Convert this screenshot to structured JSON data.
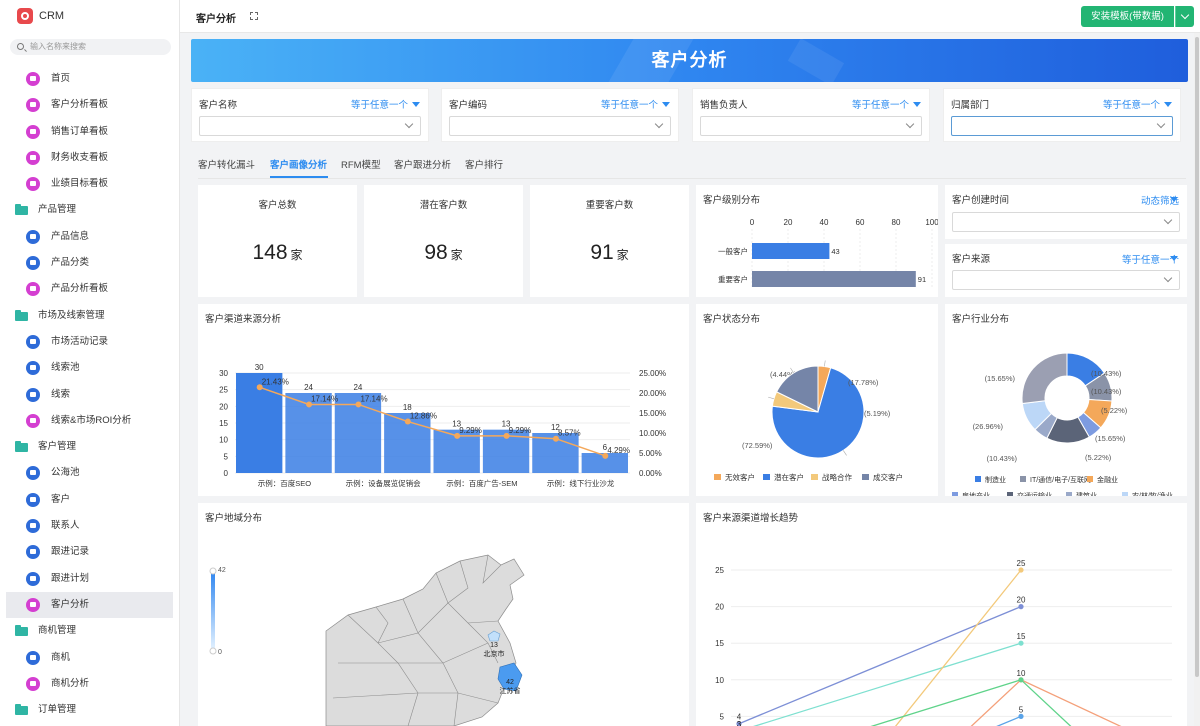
{
  "app": {
    "name": "CRM"
  },
  "search": {
    "placeholder": "输入名称来搜索"
  },
  "sidebar": {
    "items": [
      {
        "type": "child",
        "label": "首页",
        "icon": "dashboard-icon",
        "color": "pink"
      },
      {
        "type": "child",
        "label": "客户分析看板",
        "icon": "dashboard-icon",
        "color": "pink"
      },
      {
        "type": "child",
        "label": "销售订单看板",
        "icon": "dashboard-icon",
        "color": "pink"
      },
      {
        "type": "child",
        "label": "财务收支看板",
        "icon": "dashboard-icon",
        "color": "pink"
      },
      {
        "type": "child",
        "label": "业绩目标看板",
        "icon": "dashboard-icon",
        "color": "pink"
      },
      {
        "type": "group",
        "label": "产品管理",
        "icon": "folder-icon"
      },
      {
        "type": "child",
        "label": "产品信息",
        "icon": "list-icon",
        "color": "blue"
      },
      {
        "type": "child",
        "label": "产品分类",
        "icon": "category-icon",
        "color": "blue"
      },
      {
        "type": "child",
        "label": "产品分析看板",
        "icon": "dashboard-icon",
        "color": "pink"
      },
      {
        "type": "group",
        "label": "市场及线索管理",
        "icon": "folder-icon"
      },
      {
        "type": "child",
        "label": "市场活动记录",
        "icon": "list-icon",
        "color": "blue"
      },
      {
        "type": "child",
        "label": "线索池",
        "icon": "pool-icon",
        "color": "blue"
      },
      {
        "type": "child",
        "label": "线索",
        "icon": "clue-icon",
        "color": "blue"
      },
      {
        "type": "child",
        "label": "线索&市场ROI分析",
        "icon": "dashboard-icon",
        "color": "pink"
      },
      {
        "type": "group",
        "label": "客户管理",
        "icon": "folder-icon"
      },
      {
        "type": "child",
        "label": "公海池",
        "icon": "pool-icon",
        "color": "blue"
      },
      {
        "type": "child",
        "label": "客户",
        "icon": "user-icon",
        "color": "blue"
      },
      {
        "type": "child",
        "label": "联系人",
        "icon": "contact-icon",
        "color": "blue"
      },
      {
        "type": "child",
        "label": "跟进记录",
        "icon": "record-icon",
        "color": "blue"
      },
      {
        "type": "child",
        "label": "跟进计划",
        "icon": "plan-icon",
        "color": "blue"
      },
      {
        "type": "child",
        "label": "客户分析",
        "icon": "dashboard-icon",
        "color": "pink",
        "active": true
      },
      {
        "type": "group",
        "label": "商机管理",
        "icon": "folder-icon"
      },
      {
        "type": "child",
        "label": "商机",
        "icon": "opportunity-icon",
        "color": "blue"
      },
      {
        "type": "child",
        "label": "商机分析",
        "icon": "dashboard-icon",
        "color": "pink"
      },
      {
        "type": "group",
        "label": "订单管理",
        "icon": "folder-icon"
      }
    ]
  },
  "topbar": {
    "tab": "客户分析",
    "install_label": "安装模板(带数据)"
  },
  "banner": {
    "title": "客户分析"
  },
  "filters": [
    {
      "label": "客户名称",
      "op": "等于任意一个"
    },
    {
      "label": "客户编码",
      "op": "等于任意一个"
    },
    {
      "label": "销售负责人",
      "op": "等于任意一个"
    },
    {
      "label": "归属部门",
      "op": "等于任意一个"
    }
  ],
  "tabs": [
    "客户转化漏斗",
    "客户画像分析",
    "RFM模型",
    "客户跟进分析",
    "客户排行"
  ],
  "kpis": [
    {
      "label": "客户总数",
      "value": "148",
      "unit": "家"
    },
    {
      "label": "潜在客户数",
      "value": "98",
      "unit": "家"
    },
    {
      "label": "重要客户数",
      "value": "91",
      "unit": "家"
    }
  ],
  "side_filters": [
    {
      "label": "客户创建时间",
      "op": "动态筛选"
    },
    {
      "label": "客户来源",
      "op": "等于任意一个"
    }
  ],
  "colors": {
    "blue": "#3a7ee4",
    "orange": "#f4a85a",
    "green": "#22b573",
    "slate": "#7585a8",
    "gray": "#d9d9d9"
  },
  "chart_data": [
    {
      "id": "level",
      "type": "bar",
      "orientation": "horizontal",
      "title": "客户级别分布",
      "categories": [
        "一般客户",
        "重要客户"
      ],
      "values": [
        43,
        91
      ],
      "xlim": [
        0,
        100
      ],
      "xticks": [
        0,
        20,
        40,
        60,
        80,
        100
      ],
      "colors": [
        "#3a7ee4",
        "#7585a8"
      ]
    },
    {
      "id": "channel",
      "type": "bar+line",
      "title": "客户渠道来源分析",
      "categories": [
        "示例：百度SEO",
        "示例：设备展览促销会",
        "示例：百度广告-SEM",
        "示例：线下行业沙龙",
        "",
        "",
        "",
        ""
      ],
      "xticklabels": [
        "示例：百度SEO",
        "示例：设备展览促销会",
        "示例：百度广告-SEM",
        "示例：线下行业沙龙"
      ],
      "series": [
        {
          "name": "客户数量",
          "type": "bar",
          "values": [
            30,
            24,
            24,
            18,
            13,
            13,
            12,
            6
          ],
          "color": "#3a7ee4"
        },
        {
          "name": "渠道占比",
          "type": "line",
          "values": [
            21.43,
            17.14,
            17.14,
            12.86,
            9.29,
            9.29,
            8.57,
            4.29
          ],
          "labels": [
            "21.43%",
            "17.14%",
            "17.14%",
            "12.86%",
            "9.29%",
            "9.29%",
            "8.57%",
            "4.29%"
          ],
          "color": "#f4a85a"
        }
      ],
      "ylim": [
        0,
        30
      ],
      "yticks": [
        0,
        5,
        10,
        15,
        20,
        25,
        30
      ],
      "y2lim": [
        0,
        25
      ],
      "y2ticks": [
        "0.00%",
        "5.00%",
        "10.00%",
        "15.00%",
        "20.00%",
        "25.00%"
      ]
    },
    {
      "id": "status",
      "type": "pie",
      "title": "客户状态分布",
      "slices": [
        {
          "name": "无效客户",
          "value": 4.44,
          "label": "(4.44%)",
          "color": "#f4a85a"
        },
        {
          "name": "潜在客户",
          "value": 72.59,
          "label": "(72.59%)",
          "color": "#3a7ee4"
        },
        {
          "name": "战略合作",
          "value": 5.19,
          "label": "(5.19%)",
          "color": "#f3c97b"
        },
        {
          "name": "成交客户",
          "value": 17.78,
          "label": "(17.78%)",
          "color": "#7585a8"
        }
      ]
    },
    {
      "id": "industry",
      "type": "pie",
      "donut": true,
      "title": "客户行业分布",
      "slices": [
        {
          "name": "制造业",
          "value": 15.65,
          "label": "(15.65%)",
          "color": "#3a7ee4"
        },
        {
          "name": "IT/通信/电子/互联网",
          "value": 10.43,
          "label": "(10.43%)",
          "color": "#8a93a8"
        },
        {
          "name": "金融业",
          "value": 10.43,
          "label": "(10.43%)",
          "color": "#f4a85a"
        },
        {
          "name": "房地产业",
          "value": 5.22,
          "label": "(5.22%)",
          "color": "#7d9be0"
        },
        {
          "name": "交通运输业",
          "value": 15.65,
          "label": "(15.65%)",
          "color": "#5b6478"
        },
        {
          "name": "建筑业",
          "value": 5.22,
          "label": "(5.22%)",
          "color": "#9aa9c9"
        },
        {
          "name": "农/林/牧/渔业",
          "value": 10.43,
          "label": "(10.43%)",
          "color": "#bcd7f7"
        },
        {
          "name": "贸易/批发/零售/租赁业",
          "value": 26.96,
          "label": "(26.96%)",
          "color": "#9b9fb2"
        }
      ]
    },
    {
      "id": "region",
      "type": "map",
      "title": "客户地域分布",
      "scale": {
        "min": "0",
        "max": "42"
      },
      "regions": [
        {
          "name": "北京市",
          "value": 13
        },
        {
          "name": "江苏省",
          "value": 42
        }
      ]
    },
    {
      "id": "trend",
      "type": "line",
      "title": "客户来源渠道增长趋势",
      "yticks": [
        0,
        5,
        10,
        15,
        20,
        25
      ],
      "ylim": [
        0,
        25
      ],
      "x": [
        1,
        2,
        3,
        4,
        5,
        6,
        7
      ],
      "series": [
        {
          "color": "#7d8fd6",
          "values": [
            4,
            null,
            null,
            null,
            20,
            null,
            null
          ],
          "labels": [
            "4",
            "",
            "",
            "",
            "20",
            "",
            ""
          ]
        },
        {
          "color": "#7ee0d0",
          "values": [
            3,
            null,
            null,
            null,
            15,
            null,
            null
          ],
          "labels": [
            "3",
            "",
            "",
            "",
            "15",
            "",
            ""
          ]
        },
        {
          "color": "#f3c97b",
          "values": [
            3,
            1,
            1,
            null,
            25,
            null,
            null
          ],
          "labels": [
            "3",
            "1",
            "1",
            "",
            "25",
            "",
            ""
          ]
        },
        {
          "color": "#f4a07a",
          "values": [
            1,
            1,
            1,
            1,
            10,
            null,
            1
          ],
          "labels": [
            "1",
            "1",
            "1",
            "1",
            "10",
            "",
            "1"
          ]
        },
        {
          "color": "#5fd38a",
          "values": [
            null,
            1,
            null,
            null,
            10,
            1,
            null
          ],
          "labels": [
            "",
            "1",
            "",
            "",
            "",
            "1",
            ""
          ]
        },
        {
          "color": "#5aa3e8",
          "values": [
            null,
            null,
            null,
            1,
            5,
            null,
            null
          ],
          "labels": [
            "",
            "",
            "",
            "1",
            "5",
            "",
            ""
          ]
        }
      ]
    }
  ]
}
